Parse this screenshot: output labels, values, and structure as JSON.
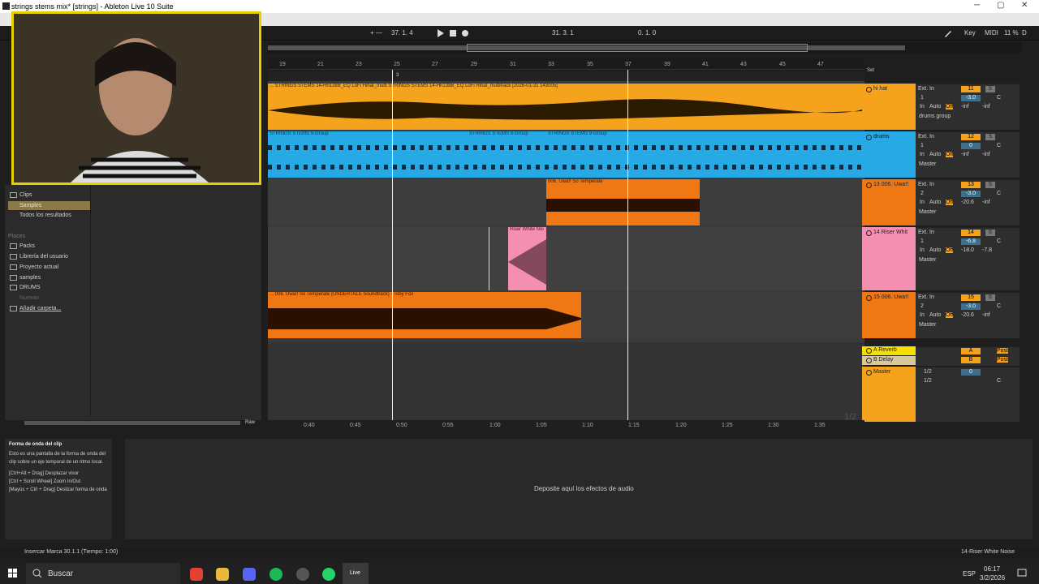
{
  "window": {
    "title": "strings stems mix* [strings] - Ableton Live 10 Suite",
    "minimize": "─",
    "maximize": "▢",
    "close": "✕"
  },
  "transport": {
    "tempo_mode": "+ —",
    "loop_start": "37.  1.  4",
    "position": "31.  3.  1",
    "loop_len": "0.  1.  0",
    "key": "Key",
    "midi": "MIDI",
    "cpu": "11 %",
    "d": "D"
  },
  "ruler": {
    "bars": [
      "19",
      "21",
      "23",
      "25",
      "27",
      "29",
      "31",
      "33",
      "35",
      "37",
      "39",
      "41",
      "43",
      "45",
      "47"
    ],
    "marker": "3",
    "set_label": "Set"
  },
  "timeline": {
    "times": [
      "0:40",
      "0:45",
      "0:50",
      "0:55",
      "1:00",
      "1:05",
      "1:10",
      "1:15",
      "1:20",
      "1:25",
      "1:30",
      "1:35"
    ],
    "page": "1/2"
  },
  "tracks": [
    {
      "name": "hi hat",
      "clip": "... STRINGS STEMS 14-Hh138B_EQ LoFi Hihat_multi STRINGS STEMS 14-Hh138B_EQ LoFi Hihat_multitrack [2026-01-31 143005]",
      "color": "#f5a31d",
      "num": "11",
      "in": "Ext. In",
      "ch": "1",
      "vol": "-3.0",
      "pan": "C",
      "l": "-inf",
      "r": "-inf",
      "out": "drums group"
    },
    {
      "name": "drums",
      "clip": "STRINGS STEMS 9-Group",
      "clip2": "STRINGS STEMS 9-Group",
      "clip3": "STRINGS STEMS 9-Group",
      "color": "#27a9e6",
      "num": "12",
      "in": "Ext. In",
      "ch": "1",
      "vol": "0",
      "pan": "C",
      "l": "-inf",
      "r": "-inf",
      "out": "Master"
    },
    {
      "name": "13 006. Uwa!!",
      "clip": "006. Uwa!! So Temperate",
      "color": "#ef7714",
      "num": "13",
      "in": "Ext. In",
      "ch": "2",
      "vol": "-3.0",
      "pan": "C",
      "l": "-20.6",
      "r": "-inf",
      "out": "Master"
    },
    {
      "name": "14 Riser Whit",
      "clip": "Riser White Noi",
      "color": "#f48fb1",
      "num": "14",
      "in": "Ext. In",
      "ch": "1",
      "vol": "-6.8",
      "pan": "C",
      "l": "-18.0",
      "r": "-7.8",
      "out": "Master"
    },
    {
      "name": "15 006. Uwa!!",
      "clip": "... 006. Uwa!! So Temperate (UNDERTALE Soundtrack) - Toby Fox",
      "color": "#ef7714",
      "num": "15",
      "in": "Ext. In",
      "ch": "2",
      "vol": "-3.0",
      "pan": "C",
      "l": "-20.6",
      "r": "-inf",
      "out": "Master"
    }
  ],
  "returns": [
    {
      "name": "A Reverb",
      "letter": "A"
    },
    {
      "name": "B Delay",
      "letter": "B"
    }
  ],
  "master": {
    "name": "Master",
    "cue": "1/2",
    "out": "1/2",
    "vol": "0",
    "pan": "C"
  },
  "io_labels": {
    "in": "In",
    "auto": "Auto",
    "off": "Off",
    "s": "S",
    "post": "Post"
  },
  "browser": {
    "items": [
      "Clips",
      "Samples",
      "Todos los resultados"
    ],
    "places_header": "Places",
    "places": [
      "Packs",
      "Librería del usuario",
      "Proyecto actual",
      "samples",
      "DRUMS",
      "Nuevas",
      "Añadir carpeta..."
    ],
    "raw": "Raw"
  },
  "info": {
    "title": "Forma de onda del clip",
    "body": "Esto es una pantalla de la forma de onda del clip sobre un eje temporal de un ritmo local.",
    "hint1": "[Ctrl+Alt + Drag] Desplazar visor",
    "hint2": "[Ctrl + Scroll Wheel] Zoom In/Out",
    "hint3": "[Mayús + Ctrl + Drag] Deslizar forma de onda"
  },
  "device": {
    "drop": "Deposite aquí los efectos de audio"
  },
  "status": {
    "left": "Insercar Marca 30.1.1 (Tiempo: 1:00)",
    "right": "14-Riser White Noise"
  },
  "taskbar": {
    "search": "Buscar",
    "lang": "ESP",
    "time": "06:17",
    "date": "3/2/2026"
  }
}
